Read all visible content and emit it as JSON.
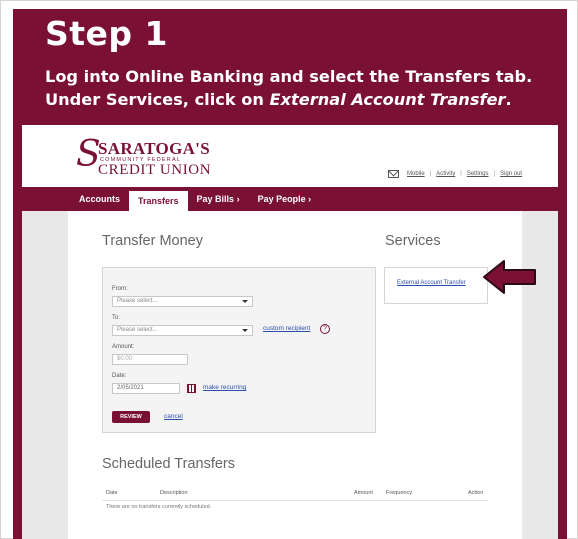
{
  "step": {
    "title": "Step 1",
    "line1": "Log into Online Banking and select the Transfers tab.",
    "line2_prefix": "Under Services, click on ",
    "line2_em": "External Account Transfer",
    "line2_suffix": "."
  },
  "colors": {
    "brand": "#7a1135",
    "link": "#2a4fa8",
    "page_bg": "#e8e8e8"
  },
  "logo": {
    "icon": "s-swirl-icon",
    "top": "SARATOGA'S",
    "middle": "COMMUNITY FEDERAL",
    "bottom": "CREDIT UNION"
  },
  "top_links": {
    "mail_icon": "mail-icon",
    "items": [
      "Mobile",
      "Activity",
      "Settings",
      "Sign out"
    ]
  },
  "nav": {
    "items": [
      "Accounts",
      "Transfers",
      "Pay Bills ›",
      "Pay People ›"
    ],
    "active": "Transfers"
  },
  "transfer": {
    "heading": "Transfer Money",
    "from_label": "From:",
    "from_value": "Please select...",
    "to_label": "To:",
    "to_value": "Please select...",
    "custom_recipient": "custom recipient",
    "help_icon": "help-circle-icon",
    "help_glyph": "?",
    "amount_label": "Amount:",
    "amount_placeholder": "$0.00",
    "date_label": "Date:",
    "date_value": "2/05/2021",
    "calendar_icon": "calendar-icon",
    "make_recurring": "make recurring",
    "review_button": "REVIEW",
    "cancel": "cancel"
  },
  "services": {
    "heading": "Services",
    "link": "External Account Transfer",
    "pointer_icon": "arrow-left-icon"
  },
  "scheduled": {
    "heading": "Scheduled Transfers",
    "columns": [
      "Date",
      "Description",
      "Amount",
      "Frequency",
      "Action"
    ],
    "empty_message": "There are no transfers currently scheduled."
  }
}
